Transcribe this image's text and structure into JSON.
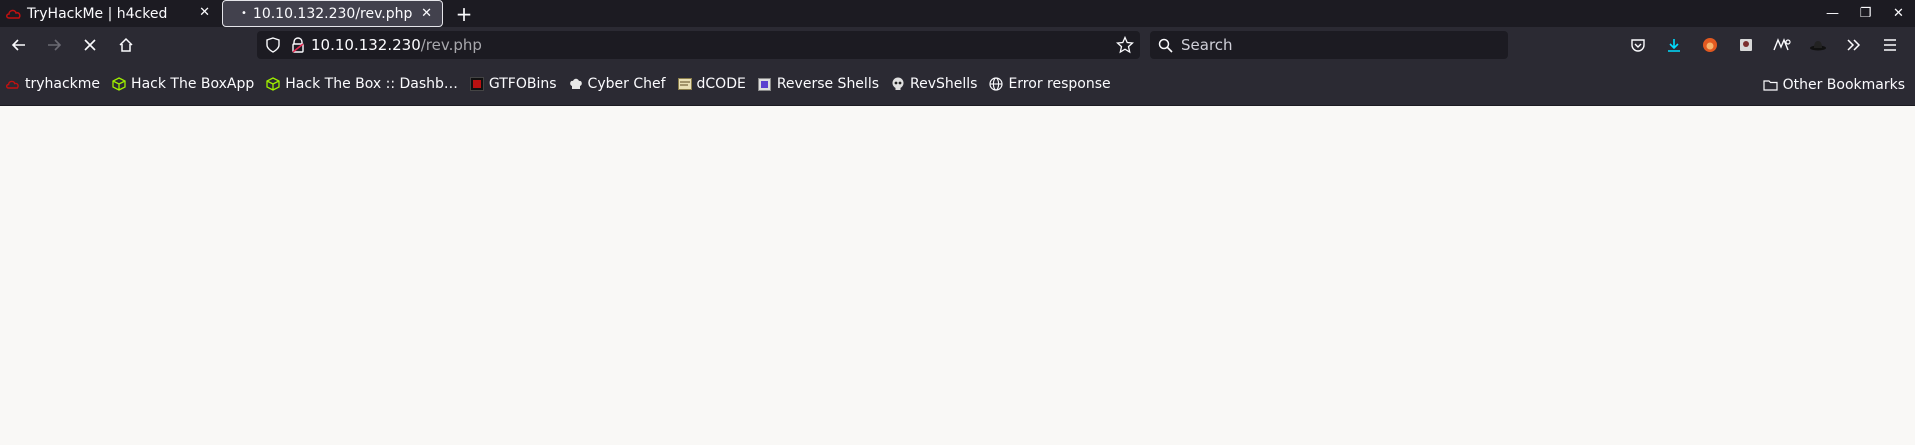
{
  "tabs": [
    {
      "title": "TryHackMe | h4cked",
      "active": false
    },
    {
      "title": "10.10.132.230/rev.php",
      "active": true
    }
  ],
  "toolbar": {
    "url_host": "10.10.132.230",
    "url_path": "/rev.php",
    "search_placeholder": "Search"
  },
  "bookmarks": [
    {
      "label": "tryhackme",
      "icon": "tryhackme-icon"
    },
    {
      "label": "Hack The BoxApp",
      "icon": "htb-cube-icon"
    },
    {
      "label": "Hack The Box :: Dashb…",
      "icon": "htb-cube-icon"
    },
    {
      "label": "GTFOBins",
      "icon": "gtfobins-icon"
    },
    {
      "label": "Cyber Chef",
      "icon": "chef-hat-icon"
    },
    {
      "label": "dCODE",
      "icon": "dcode-icon"
    },
    {
      "label": "Reverse Shells",
      "icon": "reverse-shells-icon"
    },
    {
      "label": "RevShells",
      "icon": "skull-icon"
    },
    {
      "label": "Error response",
      "icon": "globe-icon"
    }
  ],
  "other_bookmarks": "Other Bookmarks",
  "colors": {
    "tabstrip": "#1c1b22",
    "toolbar": "#2b2a33",
    "page": "#f9f8f6",
    "htb_green": "#9fef00",
    "thm_red": "#c11111",
    "download_blue": "#00ddff"
  }
}
